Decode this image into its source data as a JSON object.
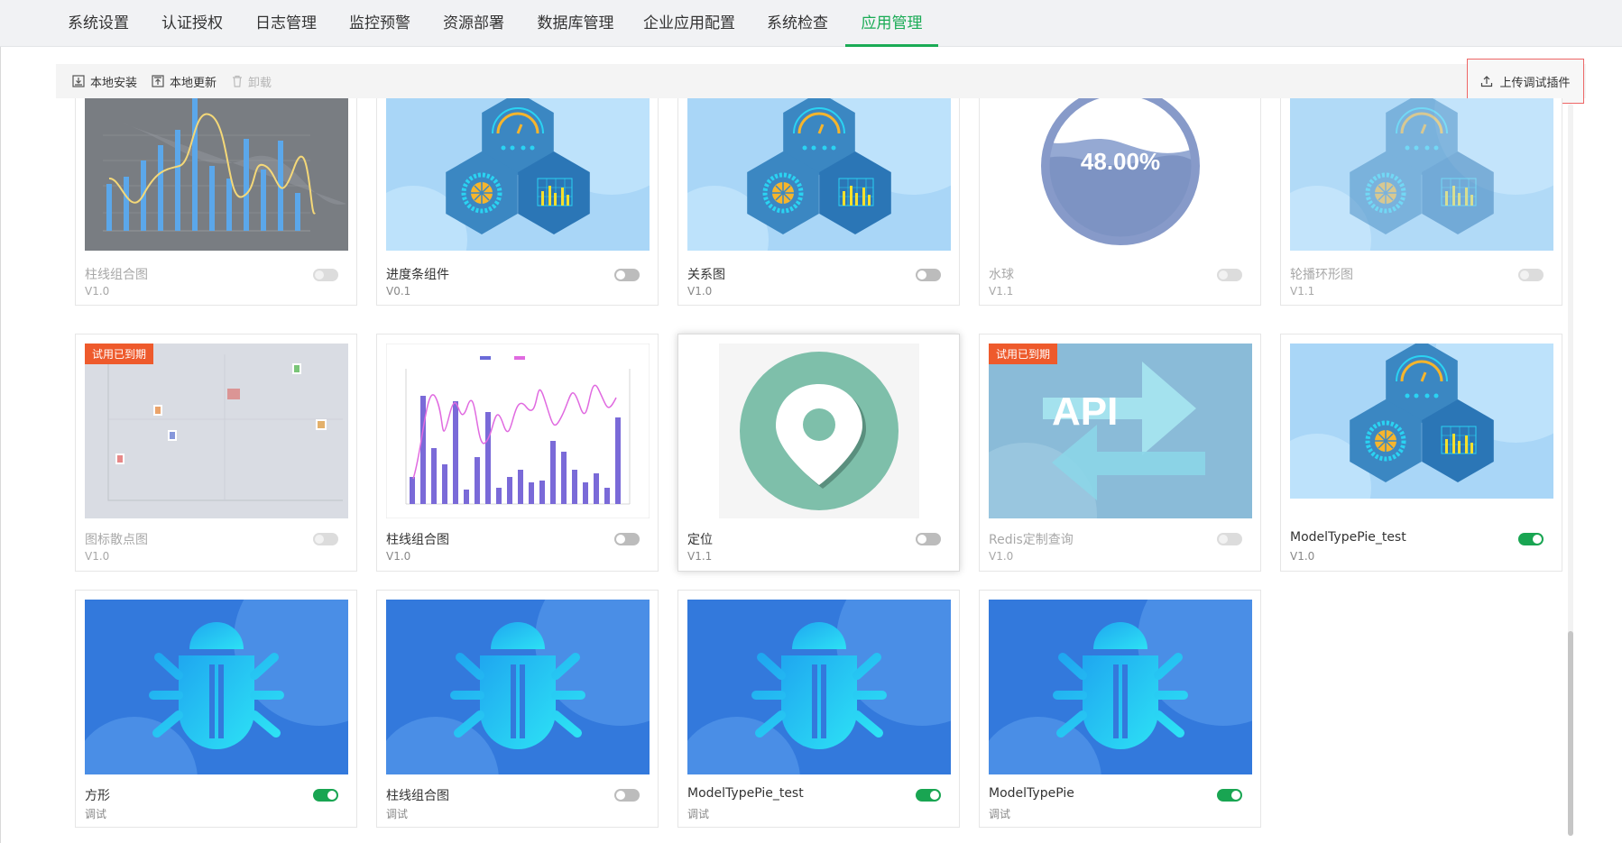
{
  "tabs": [
    "系统设置",
    "认证授权",
    "日志管理",
    "监控预警",
    "资源部署",
    "数据库管理",
    "企业应用配置",
    "系统检查",
    "应用管理"
  ],
  "active_tab": "应用管理",
  "toolbar": {
    "local_install": "本地安装",
    "local_update": "本地更新",
    "uninstall": "卸载",
    "upload_debug": "上传调试插件"
  },
  "expired_label": "试用已到期",
  "plugins": [
    {
      "name": "柱线组合图",
      "version": "V1.0",
      "toggle": "off",
      "disabled": true,
      "expired": true,
      "thumb": "dark-chart-icon"
    },
    {
      "name": "进度条组件",
      "version": "V0.1",
      "toggle": "off",
      "disabled": false,
      "expired": false,
      "thumb": "hexagon-dashboard-icon"
    },
    {
      "name": "关系图",
      "version": "V1.0",
      "toggle": "off",
      "disabled": false,
      "expired": false,
      "thumb": "hexagon-dashboard-icon"
    },
    {
      "name": "水球",
      "version": "V1.1",
      "toggle": "off",
      "disabled": true,
      "expired": true,
      "thumb": "liquid-ball-icon",
      "liquid_value": "48.00%"
    },
    {
      "name": "轮播环形图",
      "version": "V1.1",
      "toggle": "off",
      "disabled": true,
      "expired": true,
      "thumb": "hexagon-dashboard-icon"
    },
    {
      "name": "图标散点图",
      "version": "V1.0",
      "toggle": "off",
      "disabled": true,
      "expired": true,
      "thumb": "icon-scatter-icon"
    },
    {
      "name": "柱线组合图",
      "version": "V1.0",
      "toggle": "off",
      "disabled": false,
      "expired": false,
      "thumb": "bar-line-chart-icon"
    },
    {
      "name": "定位",
      "version": "V1.1",
      "toggle": "off",
      "disabled": false,
      "expired": false,
      "thumb": "location-pin-icon",
      "highlight": true
    },
    {
      "name": "Redis定制查询",
      "version": "V1.0",
      "toggle": "off",
      "disabled": true,
      "expired": true,
      "thumb": "api-arrow-icon",
      "api_text": "API"
    },
    {
      "name": "ModelTypePie_test",
      "version": "V1.0",
      "toggle": "on",
      "disabled": false,
      "expired": false,
      "thumb": "hexagon-dashboard-icon"
    },
    {
      "name": "方形",
      "version": "调试",
      "toggle": "on",
      "disabled": false,
      "expired": false,
      "thumb": "bug-icon"
    },
    {
      "name": "柱线组合图",
      "version": "调试",
      "toggle": "off",
      "disabled": false,
      "expired": false,
      "thumb": "bug-icon"
    },
    {
      "name": "ModelTypePie_test",
      "version": "调试",
      "toggle": "on",
      "disabled": false,
      "expired": false,
      "thumb": "bug-icon"
    },
    {
      "name": "ModelTypePie",
      "version": "调试",
      "toggle": "on",
      "disabled": false,
      "expired": false,
      "thumb": "bug-icon"
    }
  ]
}
